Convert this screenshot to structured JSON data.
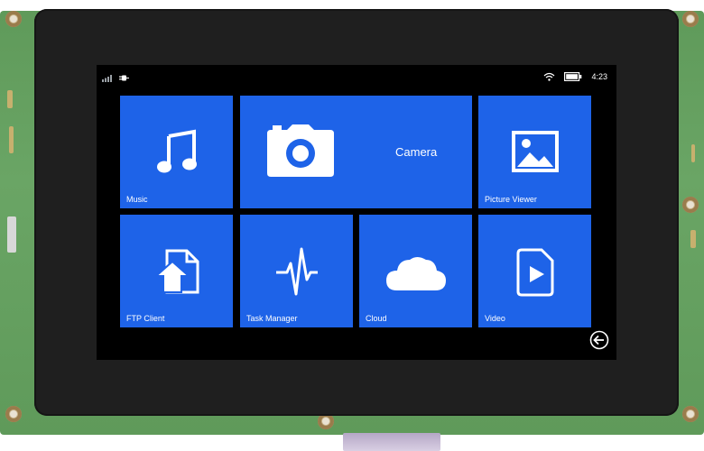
{
  "status_bar": {
    "time": "4:23",
    "left_icons": [
      "signal-icon",
      "power-plug-icon"
    ],
    "right_icons": [
      "wifi-icon",
      "battery-icon"
    ]
  },
  "tiles": {
    "music": {
      "label": "Music",
      "icon": "music-note-icon"
    },
    "camera": {
      "label": "Camera",
      "icon": "camera-icon"
    },
    "picture_viewer": {
      "label": "Picture Viewer",
      "icon": "image-icon"
    },
    "ftp_client": {
      "label": "FTP Client",
      "icon": "file-upload-icon"
    },
    "task_manager": {
      "label": "Task Manager",
      "icon": "pulse-icon"
    },
    "cloud": {
      "label": "Cloud",
      "icon": "cloud-icon"
    },
    "video": {
      "label": "Video",
      "icon": "video-file-icon"
    }
  },
  "navigation": {
    "back_icon": "back-arrow-icon"
  },
  "colors": {
    "tile_blue": "#1e63e8",
    "screen_bg": "#000000",
    "pcb_green": "#66a262",
    "bezel": "#1f1f1f"
  }
}
